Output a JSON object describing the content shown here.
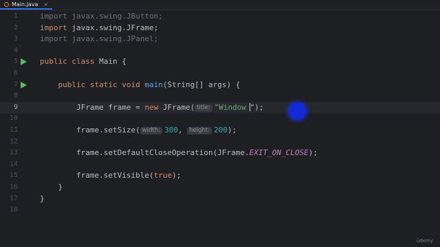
{
  "tab": {
    "filename": "Main.java",
    "close": "×"
  },
  "lines": [
    {
      "n": "1",
      "segs": [
        {
          "t": "import javax.swing.JButton;",
          "c": "imp"
        }
      ]
    },
    {
      "n": "2",
      "segs": [
        {
          "t": "import ",
          "c": "kw"
        },
        {
          "t": "javax.swing.JFrame;",
          "c": ""
        }
      ]
    },
    {
      "n": "3",
      "segs": [
        {
          "t": "import javax.swing.JPanel;",
          "c": "imp"
        }
      ]
    },
    {
      "n": "4",
      "segs": []
    },
    {
      "n": "5",
      "run": true,
      "segs": [
        {
          "t": "public class ",
          "c": "kw"
        },
        {
          "t": "Main {",
          "c": ""
        }
      ]
    },
    {
      "n": "6",
      "segs": []
    },
    {
      "n": "7",
      "run": true,
      "segs": [
        {
          "t": "    public static void ",
          "c": "kw"
        },
        {
          "t": "main",
          "c": "fn"
        },
        {
          "t": "(String[] args) {",
          "c": ""
        }
      ]
    },
    {
      "n": "8",
      "segs": []
    },
    {
      "n": "9",
      "current": true,
      "segs": [
        {
          "t": "        JFrame frame = ",
          "c": ""
        },
        {
          "t": "new ",
          "c": "kw"
        },
        {
          "t": "JFrame(",
          "c": ""
        },
        {
          "hint": "title:"
        },
        {
          "t": "\"Window ",
          "c": "str"
        },
        {
          "caret": true
        },
        {
          "t": "\");",
          "c": ""
        }
      ]
    },
    {
      "n": "10",
      "segs": []
    },
    {
      "n": "11",
      "segs": [
        {
          "t": "        frame.setSize(",
          "c": ""
        },
        {
          "hint": "width:"
        },
        {
          "t": "300",
          "c": "num"
        },
        {
          "t": ", ",
          "c": ""
        },
        {
          "hint": "height:"
        },
        {
          "t": "200",
          "c": "num"
        },
        {
          "t": ");",
          "c": ""
        }
      ]
    },
    {
      "n": "12",
      "segs": []
    },
    {
      "n": "13",
      "segs": [
        {
          "t": "        frame.setDefaultCloseOperation(JFrame.",
          "c": ""
        },
        {
          "t": "EXIT_ON_CLOSE",
          "c": "cst"
        },
        {
          "t": ");",
          "c": ""
        }
      ]
    },
    {
      "n": "14",
      "segs": []
    },
    {
      "n": "15",
      "segs": [
        {
          "t": "        frame.setVisible(",
          "c": ""
        },
        {
          "t": "true",
          "c": "kw"
        },
        {
          "t": ");",
          "c": ""
        }
      ]
    },
    {
      "n": "16",
      "segs": [
        {
          "t": "    }",
          "c": ""
        }
      ]
    },
    {
      "n": "17",
      "segs": [
        {
          "t": "}",
          "c": ""
        }
      ]
    },
    {
      "n": "18",
      "segs": []
    }
  ],
  "watermark": "ûdemy"
}
